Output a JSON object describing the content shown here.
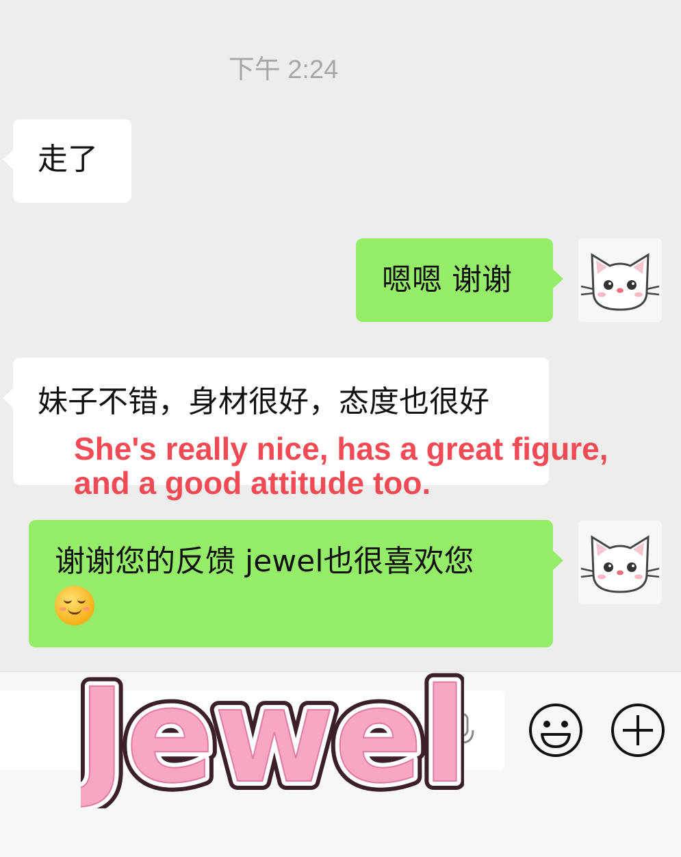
{
  "chat": {
    "timestamp": "下午 2:24",
    "messages": [
      {
        "side": "incoming",
        "text": "走了"
      },
      {
        "side": "outgoing",
        "text": "嗯嗯 谢谢"
      },
      {
        "side": "incoming",
        "text": "妹子不错，身材很好，态度也很好"
      },
      {
        "side": "outgoing",
        "text": "谢谢您的反馈 jewel也很喜欢您",
        "emoji": "smiling-face-emoji"
      }
    ],
    "translation": "She's really nice, has a great figure, and a good attitude too.",
    "avatar_icon": "cat-avatar-icon"
  },
  "input_bar": {
    "voice_icon": "microphone-icon",
    "emoji_icon": "smiley-icon",
    "plus_icon": "plus-icon"
  },
  "watermark": "Jewel",
  "colors": {
    "background": "#ededed",
    "outgoing_bubble": "#95ec69",
    "incoming_bubble": "#ffffff",
    "translation": "#f04a55",
    "watermark_fill": "#f7a6c4",
    "watermark_stroke": "#3b1f2a"
  }
}
